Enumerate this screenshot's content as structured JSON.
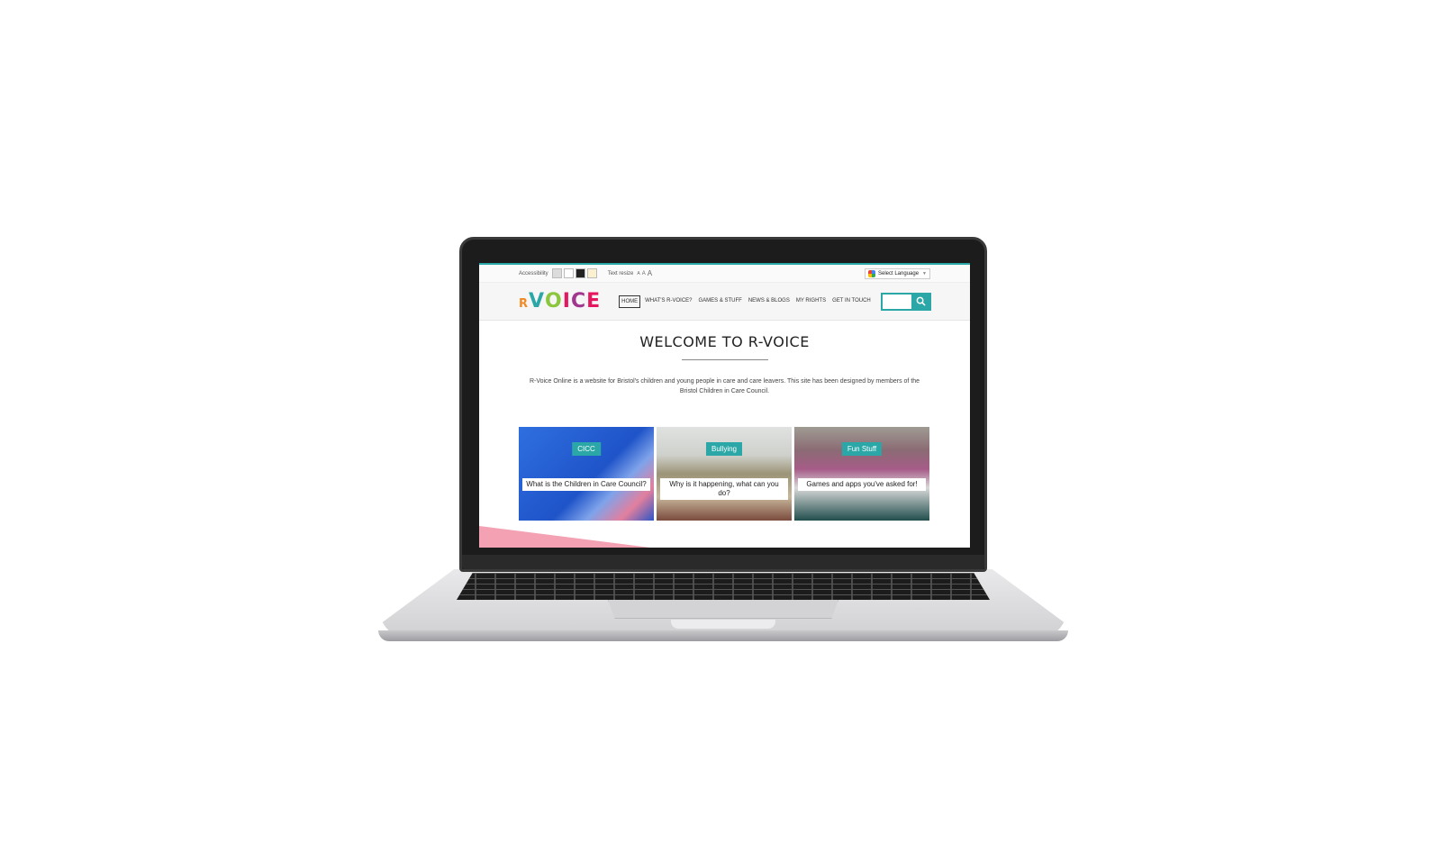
{
  "topbar": {
    "accessibility_label": "Accessibility",
    "swatches": [
      "#dcdcdc",
      "#ffffff",
      "#222222",
      "#fbf1d1"
    ],
    "text_resize_label": "Text resize",
    "resize_options": [
      "A",
      "A",
      "A"
    ],
    "language_label": "Select Language",
    "language_arrow": "▼"
  },
  "header": {
    "logo": {
      "r": "R",
      "v": "V",
      "o": "O",
      "i": "I",
      "c": "C",
      "e": "E"
    },
    "nav": [
      "HOME",
      "WHAT'S R-VOICE?",
      "GAMES & STUFF",
      "NEWS & BLOGS",
      "MY RIGHTS",
      "GET IN TOUCH"
    ],
    "search_placeholder": "",
    "search_icon": "search-icon"
  },
  "main": {
    "title": "WELCOME TO R-VOICE",
    "intro": "R-Voice Online is a website for Bristol's children and young people in care and care leavers. This site has been designed by members of the Bristol Children in Care Council."
  },
  "cards": [
    {
      "tag": "CICC",
      "caption": "What is the Children in Care Council?"
    },
    {
      "tag": "Bullying",
      "caption": "Why is it happening, what can you do?"
    },
    {
      "tag": "Fun Stuff",
      "caption": "Games and apps you've asked for!"
    }
  ],
  "colors": {
    "accent": "#2aa7a6",
    "pink": "#f4a2b3"
  }
}
